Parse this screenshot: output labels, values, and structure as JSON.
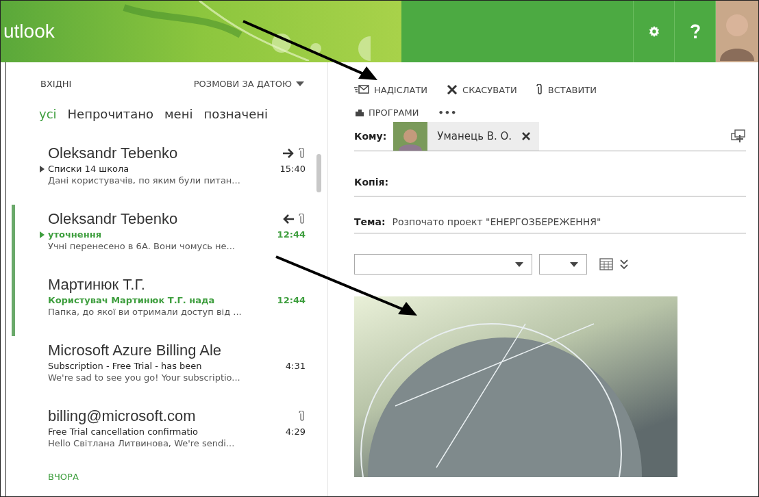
{
  "header": {
    "title": "utlook"
  },
  "mail_list": {
    "folder": "ВХІДНІ",
    "sort": "РОЗМОВИ ЗА ДАТОЮ",
    "filters": [
      {
        "label": "усі",
        "selected": true
      },
      {
        "label": "Непрочитано",
        "selected": false
      },
      {
        "label": "мені",
        "selected": false
      },
      {
        "label": "позначені",
        "selected": false
      }
    ],
    "messages": [
      {
        "sender": "Oleksandr Tebenko",
        "subject": "Списки 14 школа",
        "preview": "Дані користувачів, по яким були питан...",
        "time": "15:40",
        "unread": false,
        "thread": true,
        "forwarded": true,
        "replied": false,
        "attachment": true
      },
      {
        "sender": "Oleksandr Tebenko",
        "subject": "уточнення",
        "preview": "Учні перенесено в 6А. Вони чомусь не...",
        "time": "12:44",
        "unread": true,
        "thread": true,
        "forwarded": false,
        "replied": true,
        "attachment": true
      },
      {
        "sender": "Мартинюк Т.Г.",
        "subject": "Користувач Мартинюк Т.Г. нада",
        "preview": "Папка, до якої ви отримали доступ від ...",
        "time": "12:44",
        "unread": true,
        "thread": false,
        "forwarded": false,
        "replied": false,
        "attachment": false
      },
      {
        "sender": "Microsoft Azure Billing Ale",
        "subject": "Subscription - Free Trial - has been",
        "preview": "We're sad to see you go! Your subscriptio...",
        "time": "4:31",
        "unread": false,
        "thread": false,
        "forwarded": false,
        "replied": false,
        "attachment": false
      },
      {
        "sender": "billing@microsoft.com",
        "subject": "Free Trial cancellation confirmatio",
        "preview": "Hello Світлана Литвинова,   We're sendi...",
        "time": "4:29",
        "unread": false,
        "thread": false,
        "forwarded": false,
        "replied": false,
        "attachment": true
      }
    ],
    "group_label": "ВЧОРА"
  },
  "compose": {
    "toolbar": [
      {
        "kind": "send",
        "label": "НАДІСЛАТИ"
      },
      {
        "kind": "cancel",
        "label": "СКАСУВАТИ"
      },
      {
        "kind": "attach",
        "label": "ВСТАВИТИ"
      },
      {
        "kind": "apps",
        "label": "ПРОГРАМИ"
      },
      {
        "kind": "more",
        "label": "•••"
      }
    ],
    "to_label": "Кому:",
    "recipient": "Уманець В. О.",
    "cc_label": "Копія:",
    "subject_label": "Тема:",
    "subject": "Розпочато проект \"ЕНЕРГОЗБЕРЕЖЕННЯ\""
  }
}
